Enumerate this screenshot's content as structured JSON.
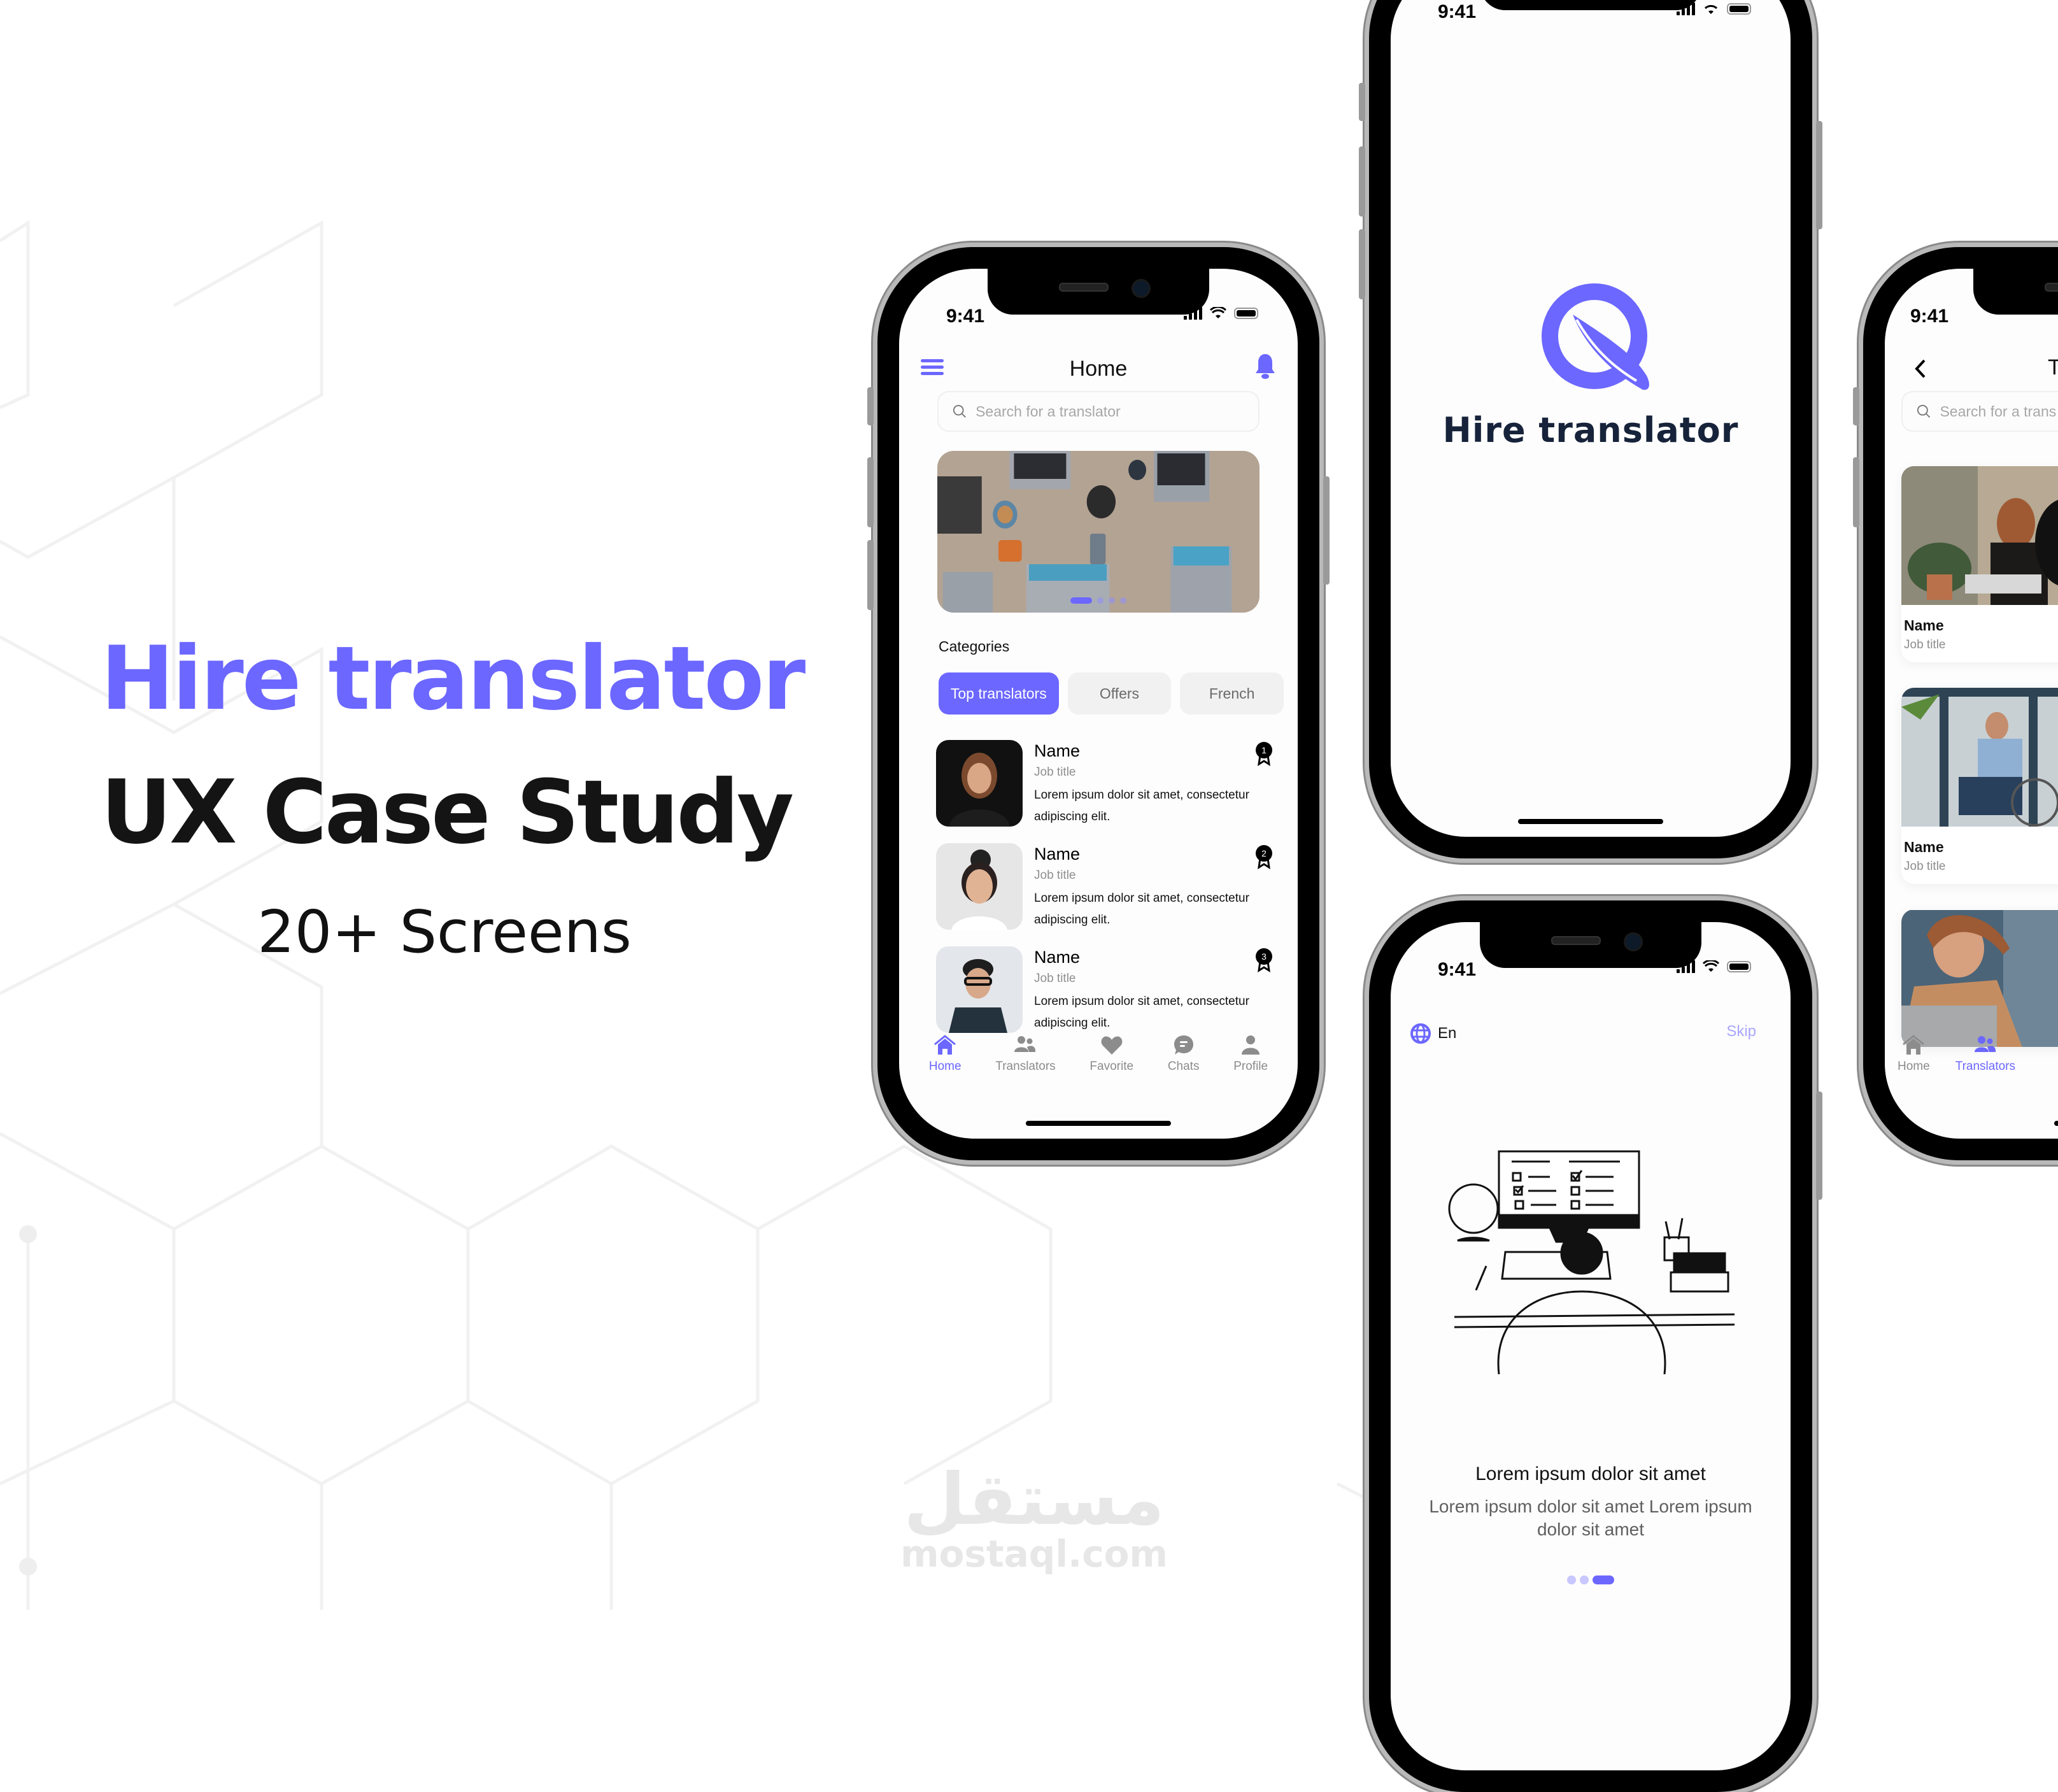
{
  "hero": {
    "title": "Hire translator",
    "subtitle": "UX Case Study",
    "count": "20+ Screens"
  },
  "colors": {
    "accent": "#6C67FF",
    "dark_text": "#141414",
    "logo_text": "#16233a",
    "muted": "#8c8c8c",
    "chip_bg": "#f1f1f1"
  },
  "status_bar": {
    "time": "9:41"
  },
  "home_screen": {
    "menu_icon": "hamburger-icon",
    "title": "Home",
    "bell_icon": "bell-icon",
    "search_placeholder": "Search for a translator",
    "banner": {
      "slides": 4,
      "active_slide": 1
    },
    "categories_label": "Categories",
    "chips": [
      {
        "label": "Top translators",
        "active": true
      },
      {
        "label": "Offers",
        "active": false
      },
      {
        "label": "French",
        "active": false
      }
    ],
    "translators": [
      {
        "name": "Name",
        "job": "Job title",
        "desc": "Lorem ipsum dolor sit amet, consectetur adipiscing elit.",
        "rank": "1"
      },
      {
        "name": "Name",
        "job": "Job title",
        "desc": "Lorem ipsum dolor sit amet, consectetur adipiscing elit.",
        "rank": "2"
      },
      {
        "name": "Name",
        "job": "Job title",
        "desc": "Lorem ipsum dolor sit amet, consectetur adipiscing elit.",
        "rank": "3"
      }
    ],
    "tabs": [
      {
        "label": "Home",
        "icon": "home-icon",
        "active": true
      },
      {
        "label": "Translators",
        "icon": "users-icon",
        "active": false
      },
      {
        "label": "Favorite",
        "icon": "heart-icon",
        "active": false
      },
      {
        "label": "Chats",
        "icon": "chat-icon",
        "active": false
      },
      {
        "label": "Profile",
        "icon": "user-icon",
        "active": false
      }
    ]
  },
  "splash_screen": {
    "logo_icon": "q-logo-icon",
    "app_name": "Hire translator"
  },
  "onboarding_screen": {
    "language": "En",
    "skip": "Skip",
    "title": "Lorem ipsum dolor sit amet",
    "description": "Lorem ipsum dolor sit amet Lorem ipsum dolor sit amet",
    "pages": 3,
    "active_page": 3
  },
  "translators_screen": {
    "title_partial": "Tra",
    "search_placeholder_partial": "Search for a trans",
    "cards": [
      {
        "name": "Name",
        "job": "Job title"
      },
      {
        "name": "Name",
        "job": "Job title"
      },
      {
        "name": "",
        "job": ""
      }
    ],
    "tabs": [
      {
        "label": "Home",
        "active": false
      },
      {
        "label": "Translators",
        "active": true
      }
    ]
  },
  "watermark": {
    "arabic": "مستقل",
    "latin": "mostaql.com"
  }
}
